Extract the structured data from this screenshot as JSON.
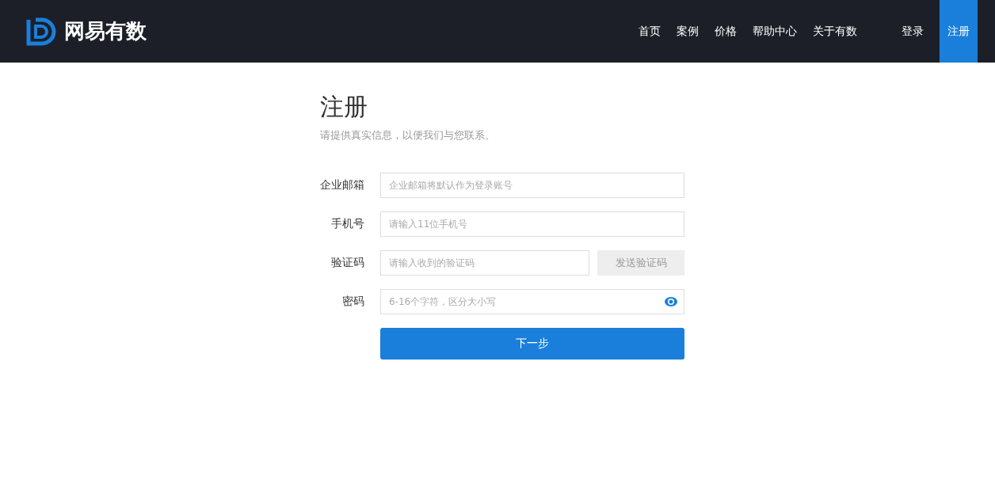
{
  "header": {
    "logo_text": "网易有数",
    "nav": [
      "首页",
      "案例",
      "价格",
      "帮助中心",
      "关于有数"
    ],
    "auth_links": [
      {
        "label": "登录",
        "selected": false
      },
      {
        "label": "注册",
        "selected": true
      }
    ]
  },
  "form": {
    "title": "注册",
    "subtitle": "请提供真实信息，以便我们与您联系。",
    "fields": [
      {
        "kind": "text",
        "label": "企业邮箱",
        "placeholder": "企业邮箱将默认作为登录账号"
      },
      {
        "kind": "text",
        "label": "手机号",
        "placeholder": "请输入11位手机号"
      },
      {
        "kind": "code",
        "label": "验证码",
        "placeholder": "请输入收到的验证码",
        "button": "发送验证码"
      },
      {
        "kind": "password",
        "label": "密码",
        "placeholder": "6-16个字符，区分大小写"
      }
    ],
    "submit": "下一步"
  }
}
